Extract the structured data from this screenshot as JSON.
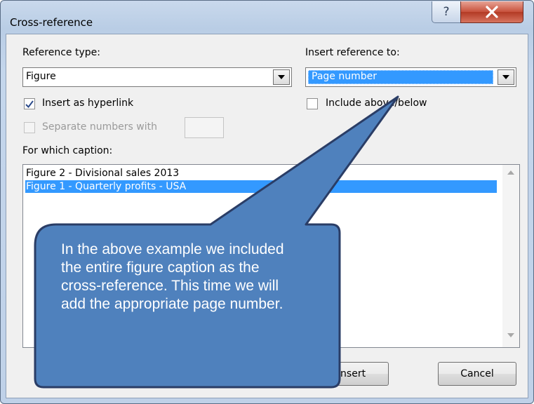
{
  "window": {
    "title": "Cross-reference"
  },
  "reference_type": {
    "label": "Reference type:",
    "value": "Figure"
  },
  "insert_reference_to": {
    "label": "Insert reference to:",
    "value": "Page number"
  },
  "insert_as_hyperlink": {
    "label": "Insert as hyperlink",
    "checked": true
  },
  "include_above_below": {
    "label": "Include above/below",
    "checked": false
  },
  "separate_numbers": {
    "label": "Separate numbers with",
    "value": ""
  },
  "caption_list": {
    "label": "For which caption:",
    "items": [
      {
        "text": "Figure 2 - Divisional sales 2013",
        "selected": false
      },
      {
        "text": "Figure 1 - Quarterly profits - USA",
        "selected": true
      }
    ]
  },
  "buttons": {
    "insert": "Insert",
    "cancel": "Cancel"
  },
  "callout": {
    "text": "In the above example we included the entire figure caption as the cross-reference. This time we will add the appropriate page number.",
    "fill": "#4f81bd",
    "border": "#2a3d66"
  },
  "colors": {
    "selection": "#3399ff",
    "close_button": "#c8513c"
  },
  "icons": {
    "help": "help-icon",
    "close": "close-icon",
    "dropdown": "chevron-down-icon",
    "check": "checkmark-icon"
  }
}
